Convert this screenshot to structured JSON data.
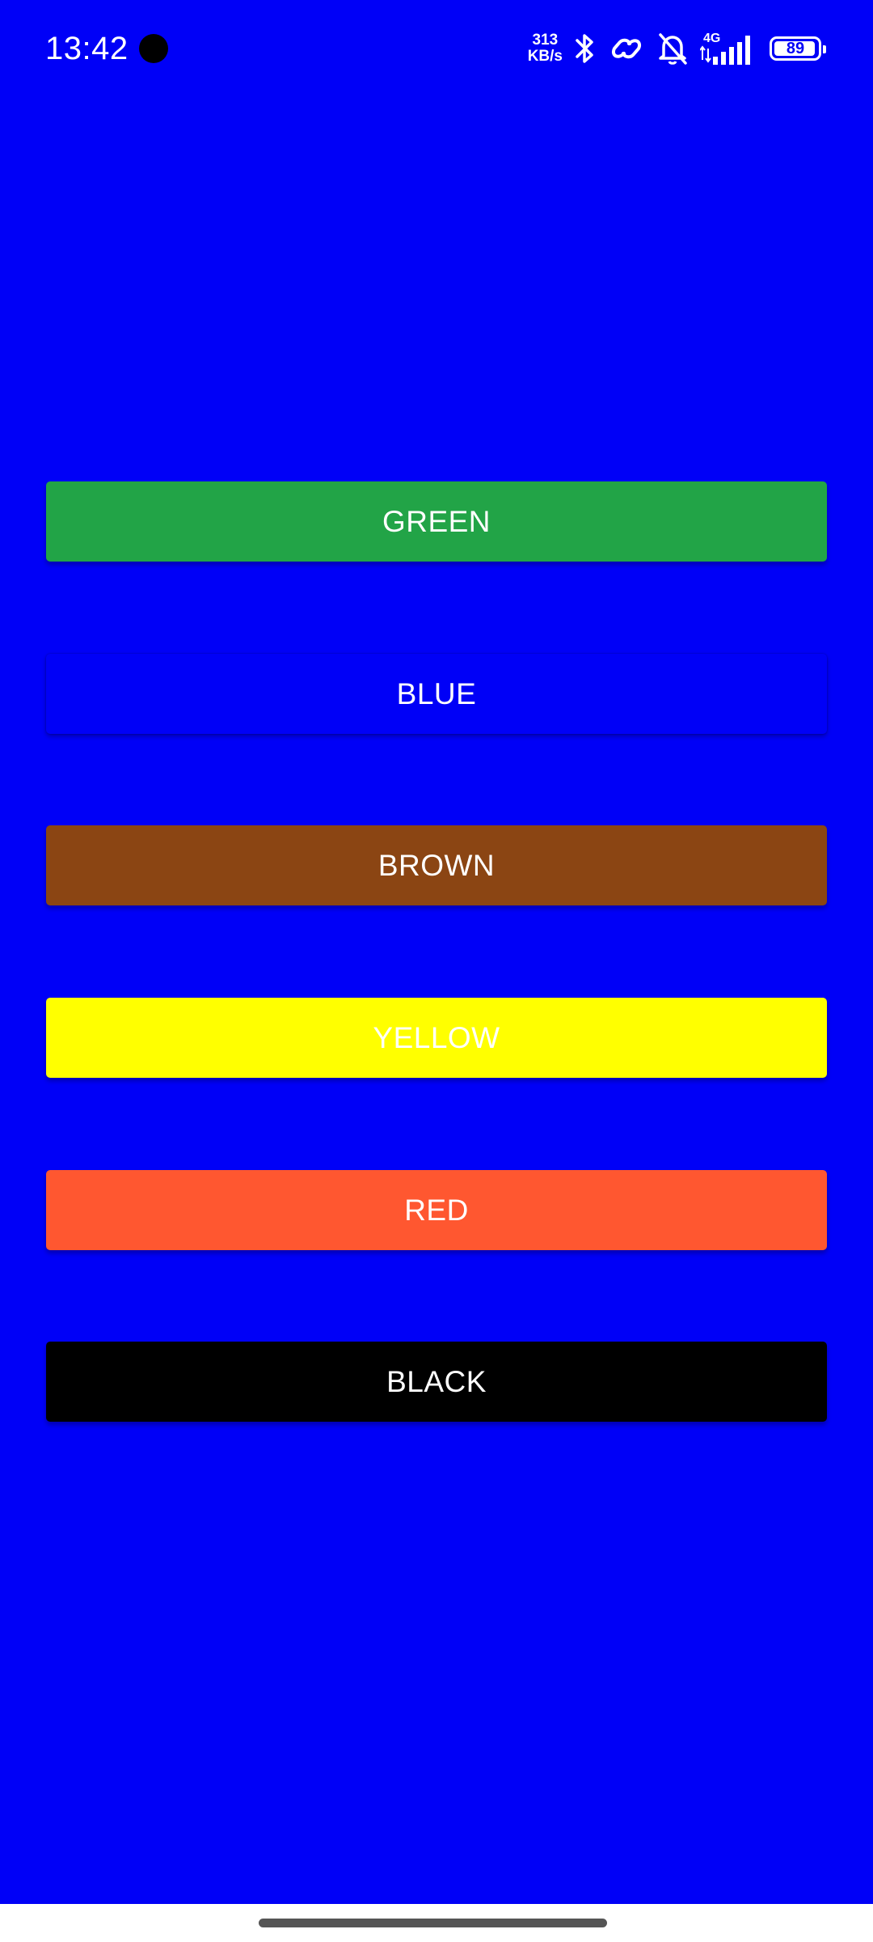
{
  "status_bar": {
    "time": "13:42",
    "net_speed_value": "313",
    "net_speed_unit": "KB/s",
    "network_type": "4G",
    "battery_level": "89",
    "icons": [
      "bluetooth-icon",
      "link-icon",
      "bell-off-icon",
      "signal-icon",
      "battery-icon"
    ]
  },
  "buttons": [
    {
      "label": "GREEN",
      "color": "#22A447"
    },
    {
      "label": "BLUE",
      "color": "#0000F7"
    },
    {
      "label": "BROWN",
      "color": "#8B4513"
    },
    {
      "label": "YELLOW",
      "color": "#FFFF00"
    },
    {
      "label": "RED",
      "color": "#FF5730"
    },
    {
      "label": "BLACK",
      "color": "#000000"
    }
  ],
  "theme": {
    "background": "#0000F7",
    "button_text": "#FFFFFF",
    "nav_bar": "#FFFFFF"
  }
}
